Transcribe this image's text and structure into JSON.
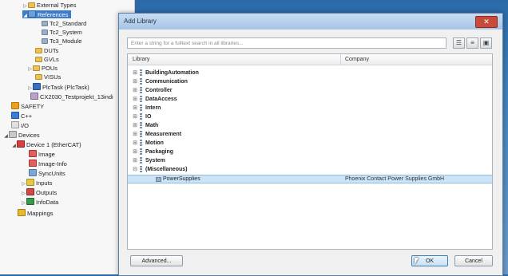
{
  "tree": {
    "items": [
      {
        "label": "External Types",
        "icon": "folder-icon",
        "exp": "▷"
      },
      {
        "label": "References",
        "icon": "references-icon",
        "exp": "◢",
        "selected": true
      },
      {
        "label": "Tc2_Standard",
        "icon": "library-icon",
        "exp": ""
      },
      {
        "label": "Tc2_System",
        "icon": "library-icon",
        "exp": ""
      },
      {
        "label": "Tc3_Module",
        "icon": "library-icon",
        "exp": ""
      },
      {
        "label": "DUTs",
        "icon": "folder-icon",
        "exp": ""
      },
      {
        "label": "GVLs",
        "icon": "folder-icon",
        "exp": ""
      },
      {
        "label": "POUs",
        "icon": "folder-icon",
        "exp": "▷"
      },
      {
        "label": "VISUs",
        "icon": "folder-icon",
        "exp": ""
      },
      {
        "label": "PlcTask (PlcTask)",
        "icon": "task-icon",
        "exp": "▷"
      },
      {
        "label": "CX2030_Testprojekt_13indi",
        "icon": "project-icon",
        "exp": ""
      },
      {
        "label": "SAFETY",
        "icon": "safety-icon",
        "exp": ""
      },
      {
        "label": "C++",
        "icon": "cpp-icon",
        "exp": ""
      },
      {
        "label": "I/O",
        "icon": "io-icon",
        "exp": ""
      },
      {
        "label": "Devices",
        "icon": "devices-icon",
        "exp": "◢"
      },
      {
        "label": "Device 1 (EtherCAT)",
        "icon": "ethercat-device-icon",
        "exp": "◢"
      },
      {
        "label": "Image",
        "icon": "image-icon",
        "exp": ""
      },
      {
        "label": "Image-Info",
        "icon": "image-icon",
        "exp": ""
      },
      {
        "label": "SyncUnits",
        "icon": "syncunits-icon",
        "exp": ""
      },
      {
        "label": "Inputs",
        "icon": "inputs-icon",
        "exp": "▷"
      },
      {
        "label": "Outputs",
        "icon": "outputs-icon",
        "exp": "▷"
      },
      {
        "label": "InfoData",
        "icon": "infodata-icon",
        "exp": "▷"
      },
      {
        "label": "Mappings",
        "icon": "mappings-icon",
        "exp": ""
      }
    ]
  },
  "dialog": {
    "title": "Add Library",
    "close_label": "✕",
    "search_placeholder": "Enter a string for a fulltext search in all libraries...",
    "columns": {
      "library": "Library",
      "company": "Company"
    },
    "categories": [
      "BuildingAutomation",
      "Communication",
      "Controller",
      "DataAccess",
      "Intern",
      "IO",
      "Math",
      "Measurement",
      "Motion",
      "Packaging",
      "System",
      "(Miscellaneous)"
    ],
    "child": {
      "label": "PowerSupplies",
      "company": "Phoenix Contact Power Supplies GmbH"
    },
    "buttons": {
      "advanced": "Advanced...",
      "ok": "OK",
      "cancel": "Cancel"
    }
  }
}
